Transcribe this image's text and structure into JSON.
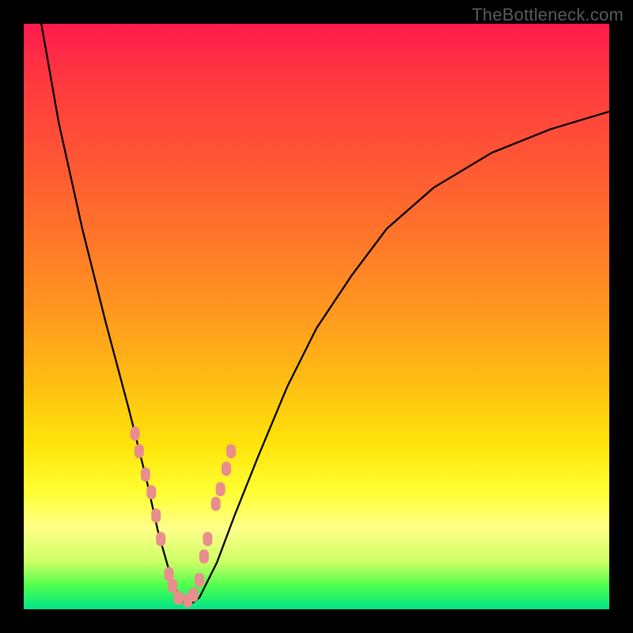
{
  "watermark": "TheBottleneck.com",
  "chart_data": {
    "type": "line",
    "title": "",
    "xlabel": "",
    "ylabel": "",
    "xlim": [
      0,
      100
    ],
    "ylim": [
      0,
      100
    ],
    "series": [
      {
        "name": "curve",
        "x": [
          3,
          6,
          10,
          14,
          18,
          21,
          23,
          25,
          26.5,
          28,
          30,
          33,
          36,
          40,
          45,
          50,
          56,
          62,
          70,
          80,
          90,
          100
        ],
        "y": [
          100,
          83,
          65,
          49,
          34,
          22,
          13,
          6,
          2,
          0.5,
          2,
          8,
          16,
          26,
          38,
          48,
          57,
          65,
          72,
          78,
          82,
          85
        ]
      }
    ],
    "markers": {
      "name": "pink-dots",
      "color": "#e98d8d",
      "x": [
        19.0,
        19.7,
        20.8,
        21.8,
        22.6,
        23.4,
        24.8,
        25.4,
        26.4,
        28.0,
        29.0,
        30.0,
        30.8,
        31.4,
        32.8,
        33.6,
        34.6,
        35.4
      ],
      "y": [
        30.0,
        27.0,
        23.0,
        20.0,
        16.0,
        12.0,
        6.0,
        4.0,
        2.0,
        1.5,
        2.5,
        5.0,
        9.0,
        12.0,
        18.0,
        20.5,
        24.0,
        27.0
      ]
    },
    "gradient_meaning": "background encodes performance mismatch: red=high bottleneck, green=optimal"
  }
}
